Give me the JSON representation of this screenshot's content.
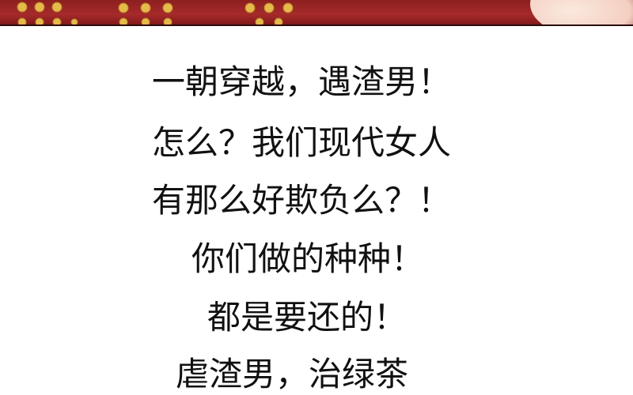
{
  "banner": {
    "background": "#9a2424",
    "dot_color": "#e5b94a"
  },
  "text_lines": [
    "一朝穿越，遇渣男！",
    "怎么？我们现代女人",
    "有那么好欺负么？！",
    "你们做的种种！",
    "都是要还的！",
    "虐渣男，治绿茶"
  ]
}
